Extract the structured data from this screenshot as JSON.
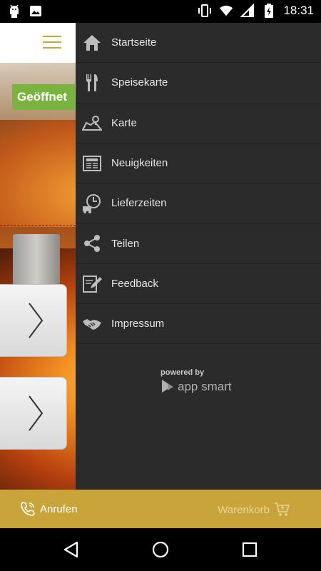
{
  "status_bar": {
    "time": "18:31",
    "left_icons": [
      "android-debug-icon",
      "photo-notification-icon"
    ],
    "right_icons": [
      "vibrate-icon",
      "wifi-icon",
      "signal-icon",
      "battery-charging-icon"
    ]
  },
  "background": {
    "status_badge": "Geöffnet"
  },
  "drawer": {
    "items": [
      {
        "label": "Startseite",
        "icon": "home-icon"
      },
      {
        "label": "Speisekarte",
        "icon": "fork-knife-icon"
      },
      {
        "label": "Karte",
        "icon": "map-icon"
      },
      {
        "label": "Neuigkeiten",
        "icon": "newspaper-icon"
      },
      {
        "label": "Lieferzeiten",
        "icon": "delivery-clock-icon"
      },
      {
        "label": "Teilen",
        "icon": "share-icon"
      },
      {
        "label": "Feedback",
        "icon": "feedback-icon"
      },
      {
        "label": "Impressum",
        "icon": "handshake-icon"
      }
    ],
    "powered_by": "powered by",
    "brand": "app smart"
  },
  "bottom_bar": {
    "call_label": "Anrufen",
    "cart_label": "Warenkorb"
  },
  "colors": {
    "accent": "#c9a43a",
    "badge_green": "#7ab33f",
    "drawer_bg": "#2b2b2b"
  }
}
